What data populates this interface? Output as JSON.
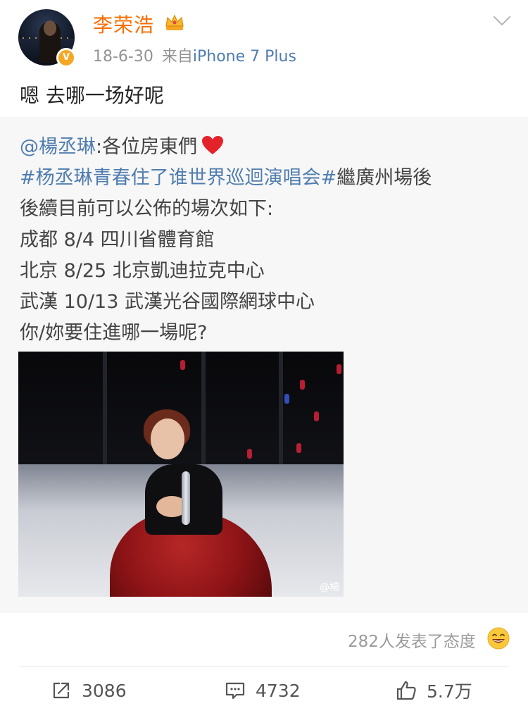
{
  "post": {
    "author": "李荣浩",
    "date": "18-6-30",
    "from_label": "来自",
    "source": "iPhone 7 Plus",
    "text": "嗯 去哪一场好呢",
    "verified_badge": "V"
  },
  "repost": {
    "mention": "@楊丞琳",
    "intro": ":各位房東們",
    "hashtag": "#杨丞琳青春住了谁世界巡迴演唱会#",
    "after_hashtag": "繼廣州場後",
    "line3": "後續目前可以公佈的場次如下:",
    "line4": "成都 8/4 四川省體育館",
    "line5": "北京 8/25 北京凱迪拉克中心",
    "line6": "武漢 10/13 武漢光谷國際網球中心",
    "line7": "你/妳要住進哪一場呢?",
    "image_watermark": "@楊"
  },
  "reactions": {
    "text": "282人发表了态度"
  },
  "actions": {
    "repost_count": "3086",
    "comment_count": "4732",
    "like_count": "5.7万"
  },
  "icons": {
    "crown": "crown-icon",
    "chevron": "chevron-down-icon",
    "heart": "heart-emoji",
    "reaction": "smile-emoji",
    "repost": "repost-icon",
    "comment": "comment-icon",
    "like": "thumbs-up-icon"
  },
  "colors": {
    "username": "#f86e00",
    "link": "#507daf",
    "meta": "#939393",
    "repost_bg": "#f7f7f7",
    "verified": "#f5a623"
  }
}
